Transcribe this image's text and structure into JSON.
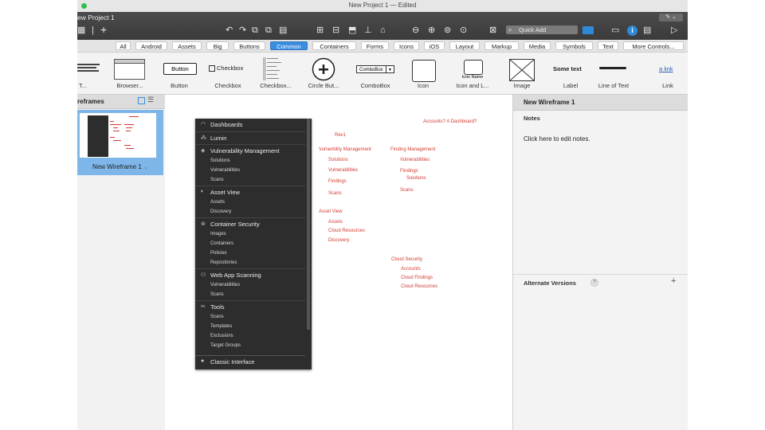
{
  "window": {
    "title": "New Project 1 — Edited"
  },
  "toolbar": {
    "project_title": "ew Project 1",
    "quick_add_placeholder": "Quick Add",
    "info_label": "i",
    "pen_label": "✎ ⌄",
    "icons": [
      "grid-icon",
      "plus-icon",
      "undo-icon",
      "redo-icon",
      "copy-icon",
      "paste-icon",
      "clipboard-icon",
      "group-icon",
      "ungroup-icon",
      "lock-icon",
      "unlock-icon",
      "zoom-out-icon",
      "zoom-in-icon",
      "zoom-fit-icon",
      "zoom-actual-icon",
      "fullscreen-icon",
      "search-icon",
      "comment-icon",
      "info-icon",
      "notes-icon",
      "present-icon"
    ]
  },
  "filters": [
    {
      "label": "All"
    },
    {
      "label": "Android"
    },
    {
      "label": "Assets"
    },
    {
      "label": "Big"
    },
    {
      "label": "Buttons"
    },
    {
      "label": "Common",
      "active": true
    },
    {
      "label": "Containers"
    },
    {
      "label": "Forms"
    },
    {
      "label": "Icons"
    },
    {
      "label": "iOS"
    },
    {
      "label": "Layout"
    },
    {
      "label": "Markup"
    },
    {
      "label": "Media"
    },
    {
      "label": "Symbols"
    },
    {
      "label": "Text"
    },
    {
      "label": "More Controls..."
    }
  ],
  "library": {
    "items": [
      {
        "label": "k of T..."
      },
      {
        "label": "Browser..."
      },
      {
        "label": "Button",
        "preview": "Button"
      },
      {
        "label": "Checkbox",
        "preview": "Checkbox"
      },
      {
        "label": "Checkbox..."
      },
      {
        "label": "Circle But..."
      },
      {
        "label": "ComboBox",
        "preview": "ComboBox"
      },
      {
        "label": "Icon"
      },
      {
        "label": "Icon and L...",
        "preview": "Icon Name"
      },
      {
        "label": "Image"
      },
      {
        "label": "Label",
        "preview": "Some text"
      },
      {
        "label": "Line of Text"
      },
      {
        "label": "Link",
        "preview": "a link"
      }
    ]
  },
  "left_panel": {
    "title": "reframes",
    "wireframe_label": "New Wireframe 1"
  },
  "canvas": {
    "sidebar": {
      "sections": [
        {
          "label": "Dashboards",
          "icon": "dashboard-icon",
          "subs": []
        },
        {
          "label": "Lumin",
          "icon": "lumin-icon",
          "subs": []
        },
        {
          "label": "Vulnerability Management",
          "icon": "shield-icon",
          "subs": [
            "Solutions",
            "Vulnerabilities",
            "Scans"
          ]
        },
        {
          "label": "Asset View",
          "icon": "asset-icon",
          "subs": [
            "Assets",
            "Discovery"
          ]
        },
        {
          "label": "Container Security",
          "icon": "container-icon",
          "subs": [
            "Images",
            "Containers",
            "Policies",
            "Repositories"
          ]
        },
        {
          "label": "Web App Scanning",
          "icon": "web-icon",
          "subs": [
            "Vulnerabilities",
            "Scans"
          ]
        },
        {
          "label": "Tools",
          "icon": "tools-icon",
          "subs": [
            "Scans",
            "Templates",
            "Exclusions",
            "Target Groups"
          ]
        }
      ],
      "footer": {
        "label": "Classic Interface",
        "icon": "classic-icon"
      }
    },
    "notes": {
      "accounts": "Accounts? A Dashboard?",
      "rev": "Rev1",
      "vm_title": "Vulnerbility Management",
      "vm_items": [
        "Solutions",
        "Vulnerabilities",
        "Findings",
        "Scans"
      ],
      "fm_title": "Finding Management",
      "fm_items": [
        "Vulnerabilities",
        "Findings",
        "Solutions",
        "Scans"
      ],
      "av_title": "Asset View",
      "av_items": [
        "Assets",
        "Cloud Resources",
        "Discovery"
      ],
      "cs_title": "Cloud Security",
      "cs_items": [
        "Accounts",
        "Cloud Findings",
        "Cloud Resources"
      ]
    }
  },
  "right_panel": {
    "title": "New Wireframe 1",
    "notes_label": "Notes",
    "click_hint": "Click here to edit notes.",
    "alt_versions": "Alternate Versions",
    "help": "?",
    "plus": "+"
  },
  "colors": {
    "accent": "#3b8de0",
    "note_red": "#d23b32",
    "sidebar_dark": "#2d2d2d"
  }
}
